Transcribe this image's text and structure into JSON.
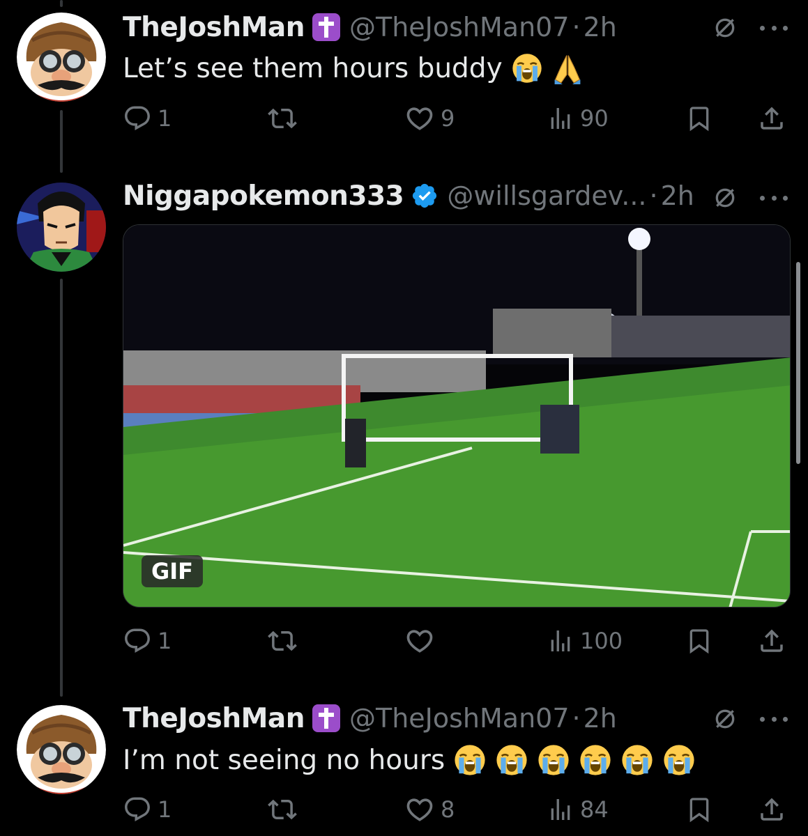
{
  "tweets": [
    {
      "display_name": "TheJoshMan",
      "badge": "cross-emoji",
      "handle": "@TheJoshMan07",
      "time": "2h",
      "text": "Let’s see them hours buddy",
      "emojis": [
        "loudly-crying-face",
        "folded-hands"
      ],
      "replies": "1",
      "reposts": "",
      "likes": "9",
      "views": "90"
    },
    {
      "display_name": "Niggapokemon333",
      "badge": "verified-badge",
      "handle": "@willsgardev...",
      "time": "2h",
      "text": "",
      "media": {
        "type": "gif",
        "badge_label": "GIF"
      },
      "replies": "1",
      "reposts": "",
      "likes": "",
      "views": "100"
    },
    {
      "display_name": "TheJoshMan",
      "badge": "cross-emoji",
      "handle": "@TheJoshMan07",
      "time": "2h",
      "text": "I’m not seeing no hours",
      "emojis": [
        "loudly-crying-face",
        "loudly-crying-face",
        "loudly-crying-face",
        "loudly-crying-face",
        "loudly-crying-face",
        "loudly-crying-face"
      ],
      "replies": "1",
      "reposts": "",
      "likes": "8",
      "views": "84"
    }
  ],
  "separator": "·",
  "colors": {
    "background": "#000000",
    "text": "#e7e9ea",
    "muted": "#71767b",
    "verified": "#1d9bf0",
    "cross_badge": "#9b4dca"
  }
}
